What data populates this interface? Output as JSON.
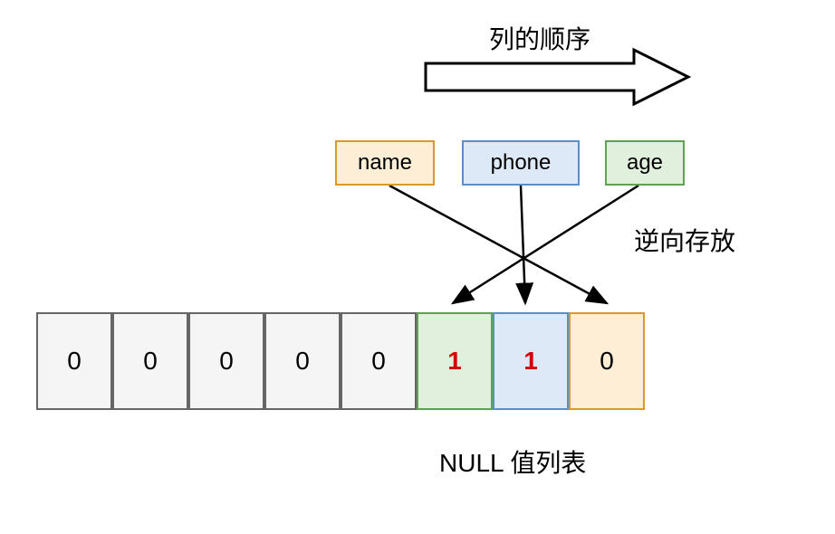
{
  "labels": {
    "column_order": "列的顺序",
    "reverse_store": "逆向存放",
    "null_list": "NULL 值列表"
  },
  "columns": [
    {
      "id": "name",
      "label": "name",
      "fill": "#fdeed5",
      "stroke": "#d99a2b"
    },
    {
      "id": "phone",
      "label": "phone",
      "fill": "#dde9f7",
      "stroke": "#5b8fc7"
    },
    {
      "id": "age",
      "label": "age",
      "fill": "#e0f0dd",
      "stroke": "#5fa052"
    }
  ],
  "bits": [
    {
      "value": "0",
      "fill": "#f5f5f5",
      "red": false
    },
    {
      "value": "0",
      "fill": "#f5f5f5",
      "red": false
    },
    {
      "value": "0",
      "fill": "#f5f5f5",
      "red": false
    },
    {
      "value": "0",
      "fill": "#f5f5f5",
      "red": false
    },
    {
      "value": "0",
      "fill": "#f5f5f5",
      "red": false
    },
    {
      "value": "1",
      "fill": "#e0f0dd",
      "red": true
    },
    {
      "value": "1",
      "fill": "#dde9f7",
      "red": true
    },
    {
      "value": "0",
      "fill": "#fdeed5",
      "red": false
    }
  ],
  "colors": {
    "cell_border": "#666666",
    "text": "#000000",
    "red": "#d40000"
  }
}
